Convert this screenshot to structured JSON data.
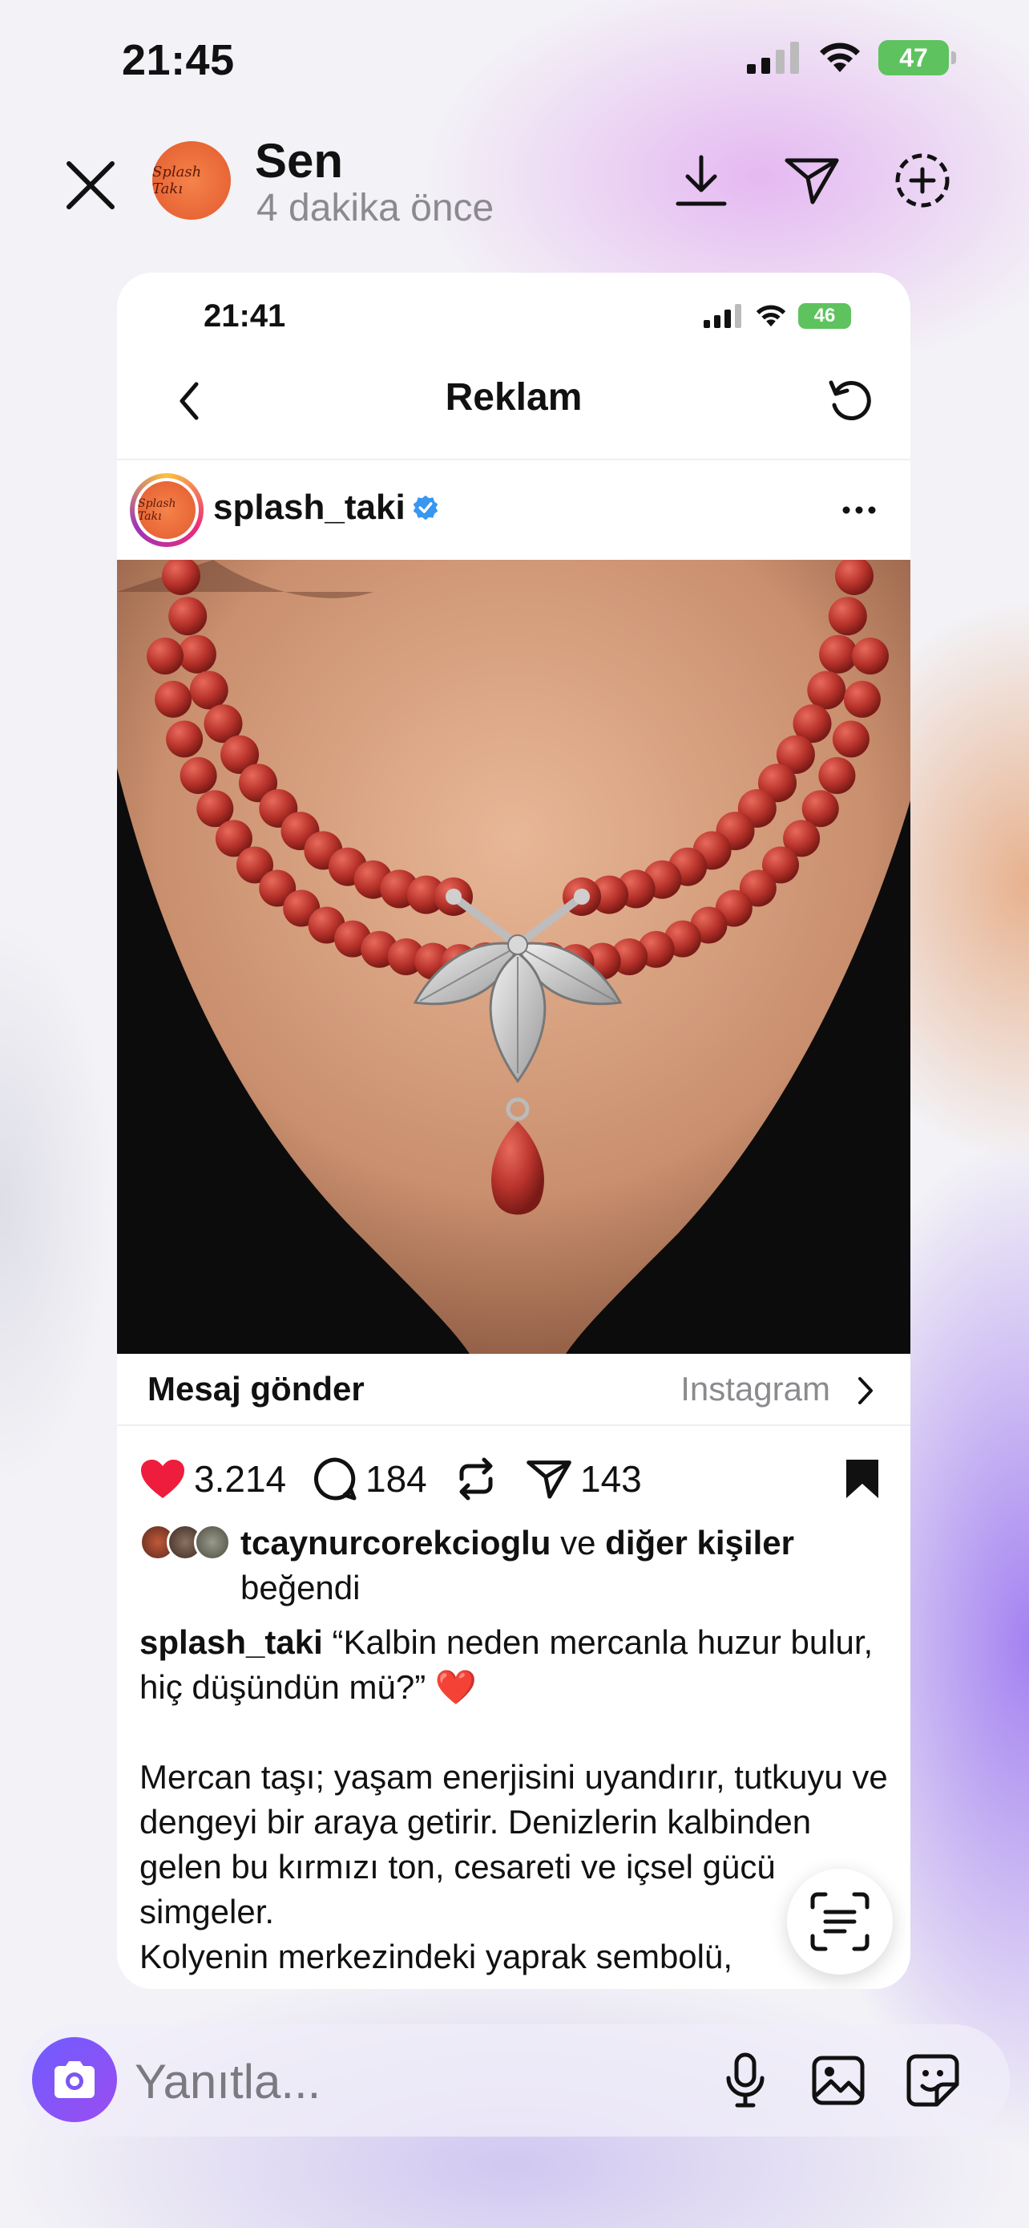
{
  "status_bar": {
    "time": "21:45",
    "battery": "47"
  },
  "story_header": {
    "name": "Sen",
    "time_ago": "4 dakika önce",
    "avatar_text": "Splash Takı"
  },
  "shared_post": {
    "status_time": "21:41",
    "battery": "46",
    "nav_title": "Reklam",
    "username": "splash_taki",
    "avatar_text": "Splash Takı",
    "message_cta": "Mesaj gönder",
    "platform": "Instagram",
    "counts": {
      "likes": "3.214",
      "comments": "184",
      "shares": "143"
    },
    "liked_by": {
      "user": "tcaynurcorekcioglu",
      "and": "ve",
      "others": "diğer kişiler",
      "suffix": "beğendi"
    },
    "caption": {
      "user": "splash_taki",
      "quote": "“Kalbin neden mercanla huzur bulur, hiç düşündün mü?” ❤️",
      "line1": "Mercan taşı; yaşam enerjisini uyandırır, tutkuyu ve dengeyi bir araya getirir. Denizlerin kalbinden gelen bu kırmızı ton, cesareti ve içsel gücü simgeler.",
      "line2": "Kolyenin merkezindeki yaprak sembolü,"
    }
  },
  "reply_bar": {
    "placeholder": "Yanıtla..."
  },
  "colors": {
    "heart": "#ee1d3d",
    "verified": "#3897f0",
    "camera": "#7b55f5"
  }
}
